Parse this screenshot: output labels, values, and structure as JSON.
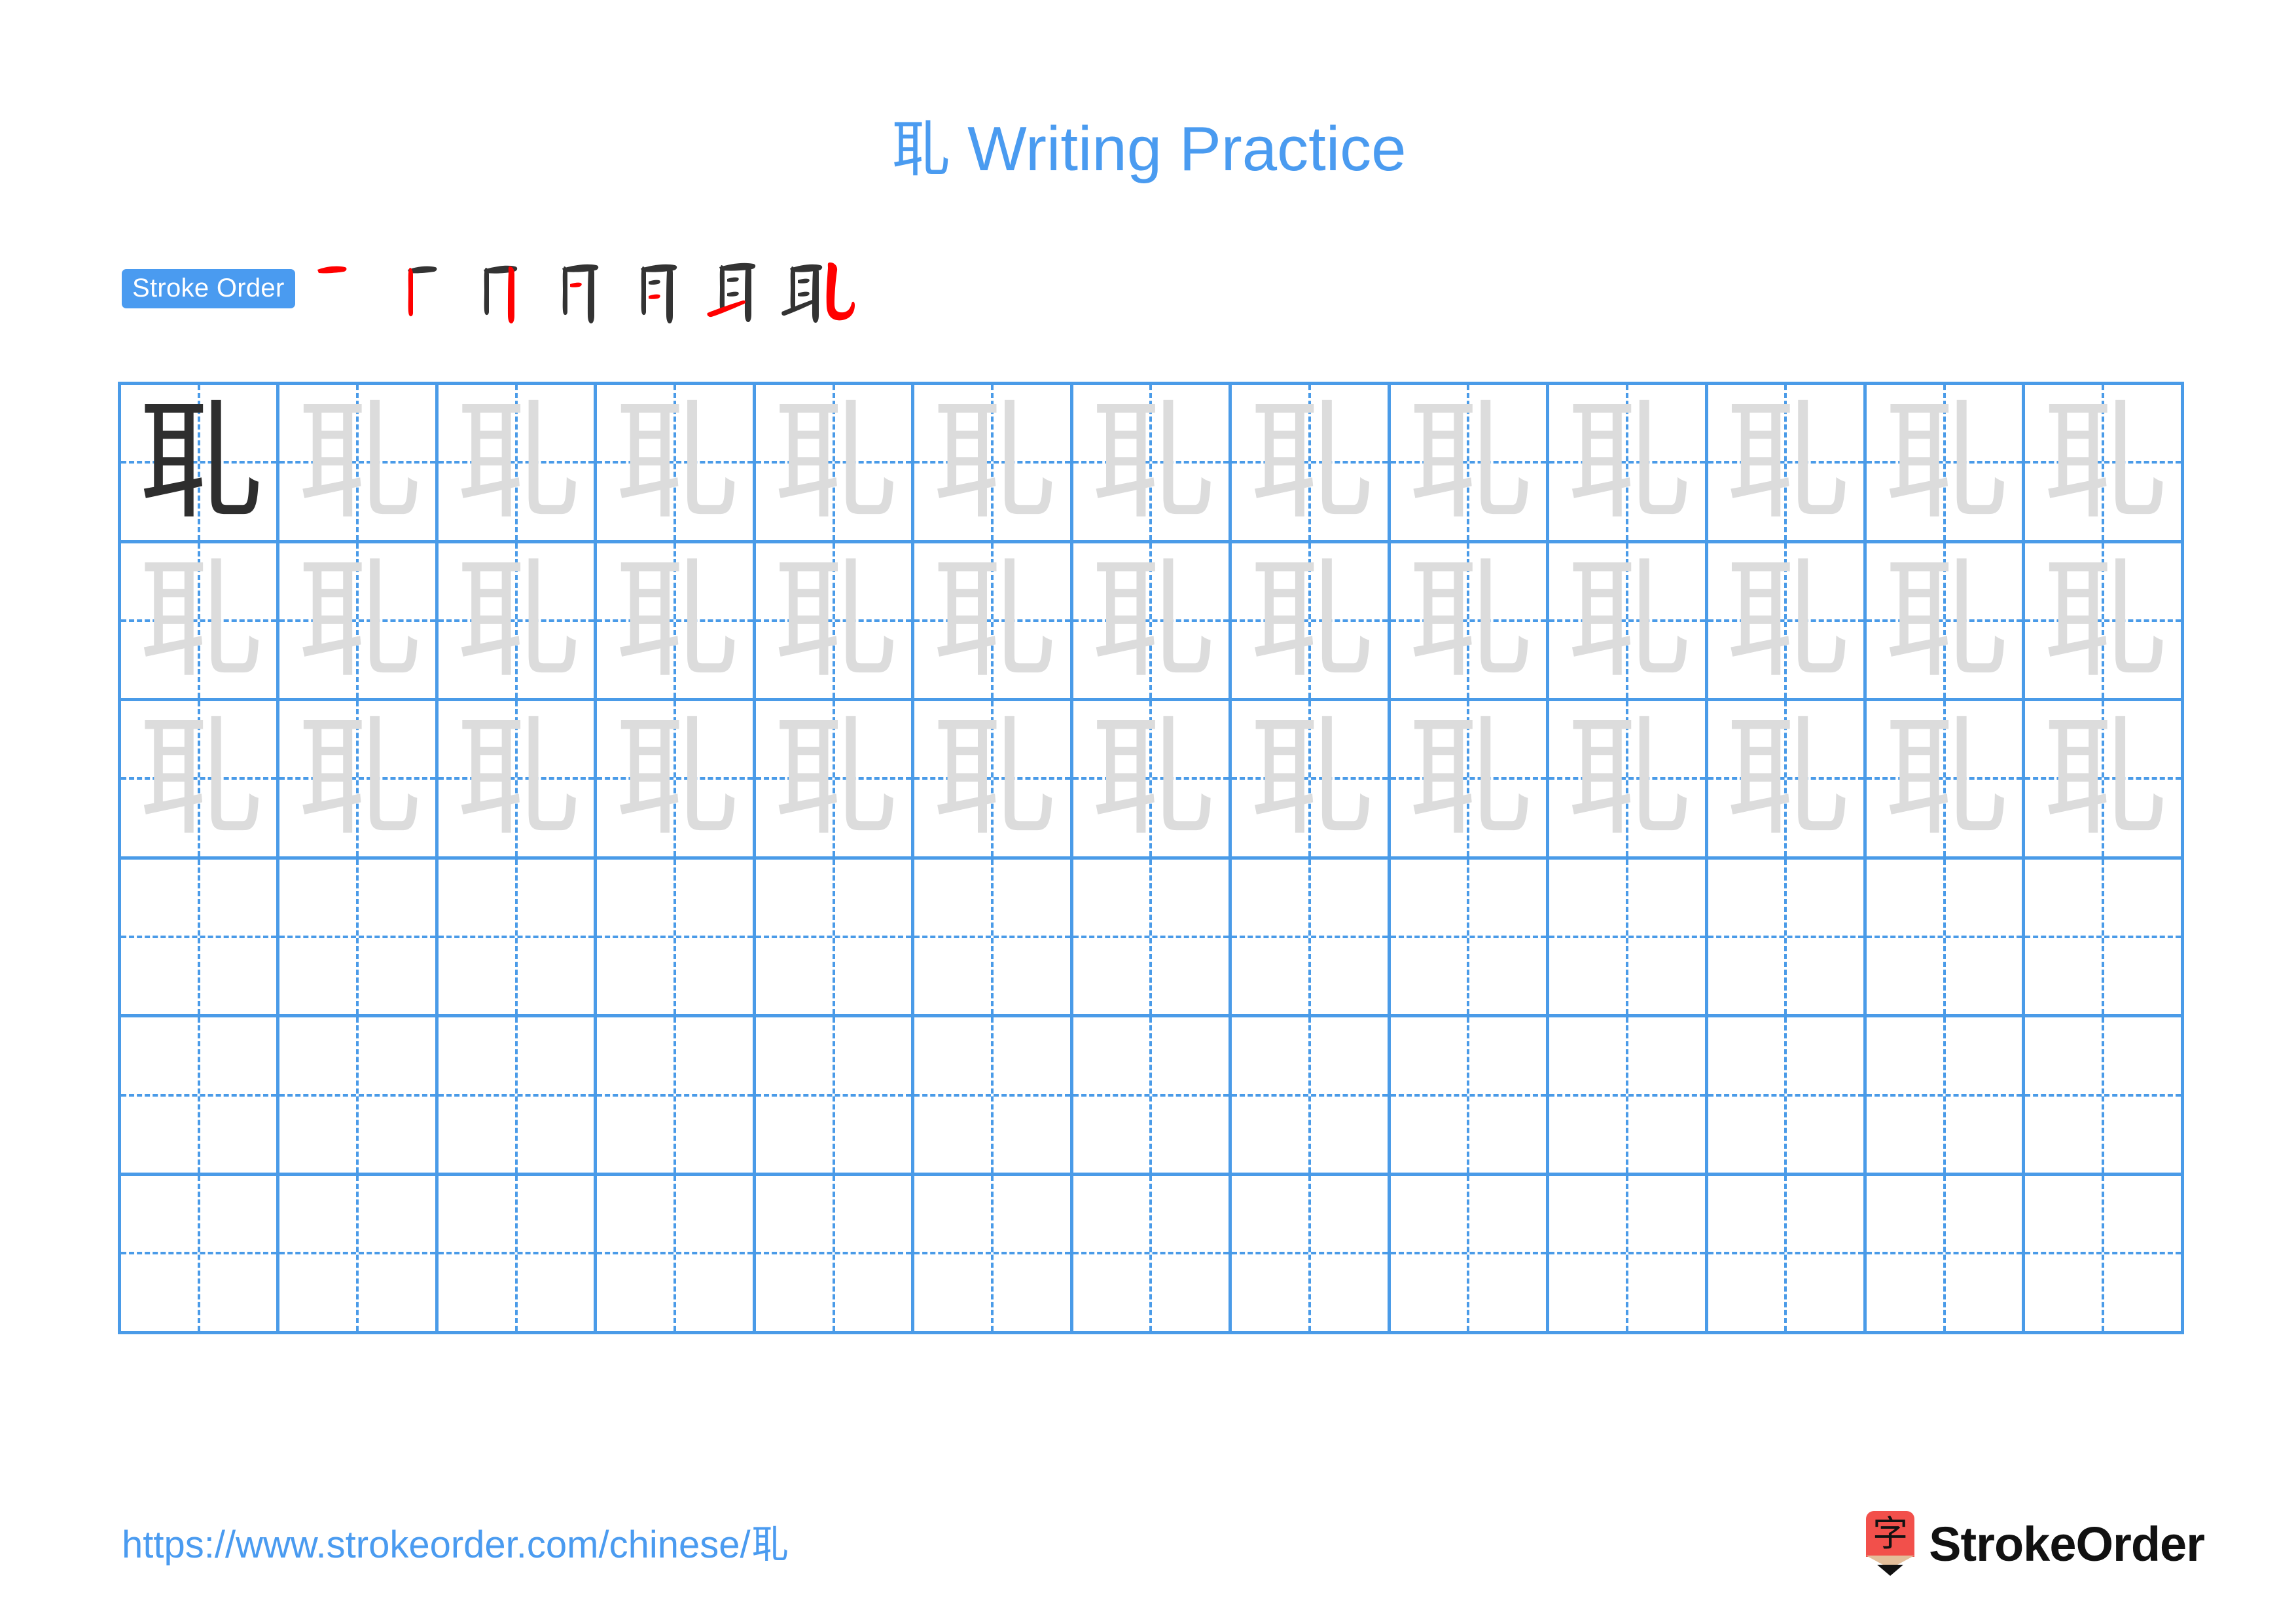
{
  "page": {
    "character": "耴",
    "title": "耴 Writing Practice",
    "title_character": "耴",
    "title_text": " Writing Practice",
    "background_color": "#ffffff",
    "accent_color": "#4A9BF0",
    "grid_line_color": "#4A9BE8",
    "trace_char_color": "#DCDCDC",
    "model_char_color": "#2E2E2E",
    "stroke_highlight_color": "#FF0000",
    "stroke_done_color": "#333333"
  },
  "stroke_order": {
    "badge_label": "Stroke Order",
    "stroke_count": 7,
    "steps": [
      {
        "index": 1,
        "description": "horizontal stroke"
      },
      {
        "index": 2,
        "description": "left vertical stroke"
      },
      {
        "index": 3,
        "description": "right vertical stroke"
      },
      {
        "index": 4,
        "description": "first inner horizontal"
      },
      {
        "index": 5,
        "description": "second inner horizontal"
      },
      {
        "index": 6,
        "description": "bottom rising stroke"
      },
      {
        "index": 7,
        "description": "final hook stroke"
      }
    ]
  },
  "grid": {
    "columns": 13,
    "rows": 6,
    "cells": [
      [
        "dark",
        "light",
        "light",
        "light",
        "light",
        "light",
        "light",
        "light",
        "light",
        "light",
        "light",
        "light",
        "light"
      ],
      [
        "light",
        "light",
        "light",
        "light",
        "light",
        "light",
        "light",
        "light",
        "light",
        "light",
        "light",
        "light",
        "light"
      ],
      [
        "light",
        "light",
        "light",
        "light",
        "light",
        "light",
        "light",
        "light",
        "light",
        "light",
        "light",
        "light",
        "light"
      ],
      [
        "empty",
        "empty",
        "empty",
        "empty",
        "empty",
        "empty",
        "empty",
        "empty",
        "empty",
        "empty",
        "empty",
        "empty",
        "empty"
      ],
      [
        "empty",
        "empty",
        "empty",
        "empty",
        "empty",
        "empty",
        "empty",
        "empty",
        "empty",
        "empty",
        "empty",
        "empty",
        "empty"
      ],
      [
        "empty",
        "empty",
        "empty",
        "empty",
        "empty",
        "empty",
        "empty",
        "empty",
        "empty",
        "empty",
        "empty",
        "empty",
        "empty"
      ]
    ]
  },
  "footer": {
    "url_prefix": "https://www.strokeorder.com/chinese/",
    "url_character": "耴",
    "url": "https://www.strokeorder.com/chinese/耴",
    "logo_glyph": "字",
    "logo_text": "StrokeOrder",
    "logo_color": "#F2504B"
  }
}
